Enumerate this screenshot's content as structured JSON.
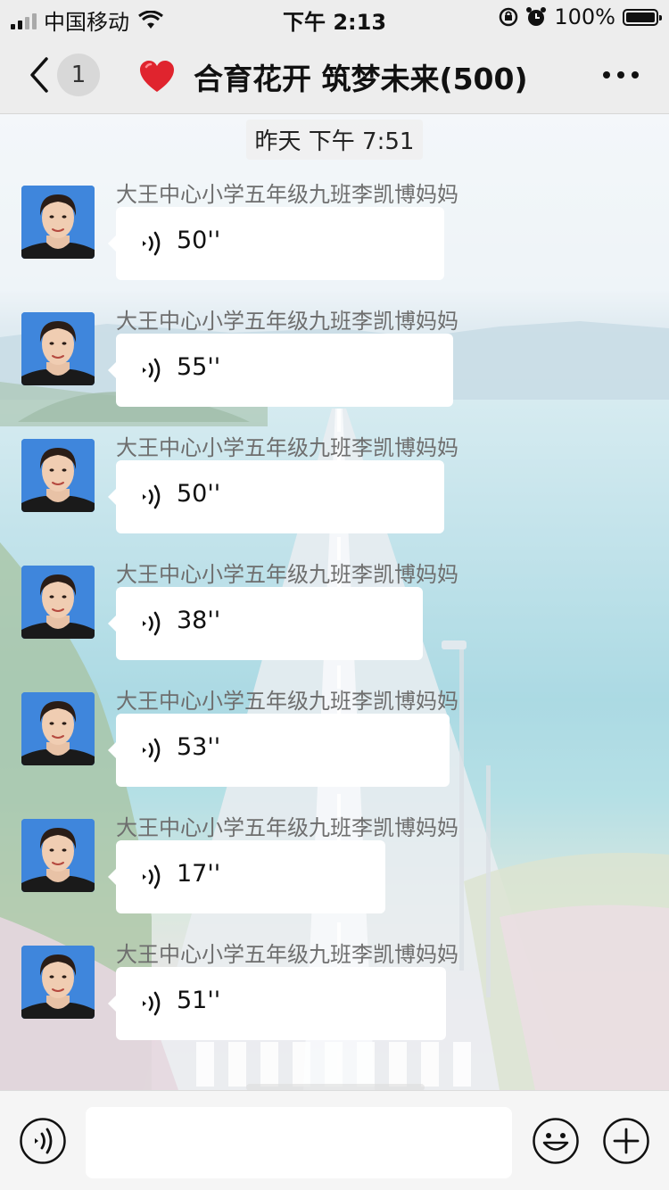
{
  "status_bar": {
    "carrier": "中国移动",
    "time": "下午 2:13",
    "battery": "100%",
    "battery_level": 1.0
  },
  "nav": {
    "unread_count": "1",
    "title": "合育花开 筑梦未来(500)"
  },
  "chat": {
    "timestamp": "昨天 下午 7:51",
    "messages": [
      {
        "sender": "大王中心小学五年级九班李凯博妈妈",
        "duration": "50''"
      },
      {
        "sender": "大王中心小学五年级九班李凯博妈妈",
        "duration": "55''"
      },
      {
        "sender": "大王中心小学五年级九班李凯博妈妈",
        "duration": "50''"
      },
      {
        "sender": "大王中心小学五年级九班李凯博妈妈",
        "duration": "38''"
      },
      {
        "sender": "大王中心小学五年级九班李凯博妈妈",
        "duration": "53''"
      },
      {
        "sender": "大王中心小学五年级九班李凯博妈妈",
        "duration": "17''"
      },
      {
        "sender": "大王中心小学五年级九班李凯博妈妈",
        "duration": "51''"
      }
    ]
  },
  "input_bar": {
    "placeholder": ""
  },
  "icons": {
    "back": "back-chevron-icon",
    "heart": "red-heart-icon",
    "more": "more-dots-icon",
    "voice": "voice-wave-icon",
    "emoji": "smiley-icon",
    "plus": "plus-circle-icon"
  }
}
